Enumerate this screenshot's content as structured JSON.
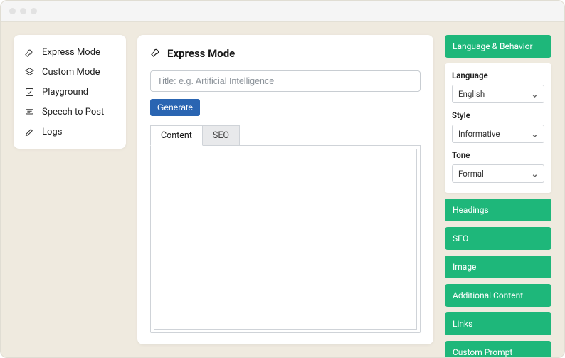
{
  "sidebar": {
    "items": [
      {
        "label": "Express Mode",
        "icon": "wrench-icon"
      },
      {
        "label": "Custom Mode",
        "icon": "layers-icon"
      },
      {
        "label": "Playground",
        "icon": "checkbox-icon"
      },
      {
        "label": "Speech to Post",
        "icon": "speech-icon"
      },
      {
        "label": "Logs",
        "icon": "pen-icon"
      }
    ]
  },
  "main": {
    "title": "Express Mode",
    "title_input_placeholder": "Title: e.g. Artificial Intelligence",
    "generate_label": "Generate",
    "tabs": {
      "content": "Content",
      "seo": "SEO"
    },
    "content_value": ""
  },
  "right": {
    "language_behavior": {
      "header": "Language & Behavior",
      "fields": {
        "language": {
          "label": "Language",
          "value": "English"
        },
        "style": {
          "label": "Style",
          "value": "Informative"
        },
        "tone": {
          "label": "Tone",
          "value": "Formal"
        }
      }
    },
    "accordions": [
      "Headings",
      "SEO",
      "Image",
      "Additional Content",
      "Links",
      "Custom Prompt"
    ]
  }
}
